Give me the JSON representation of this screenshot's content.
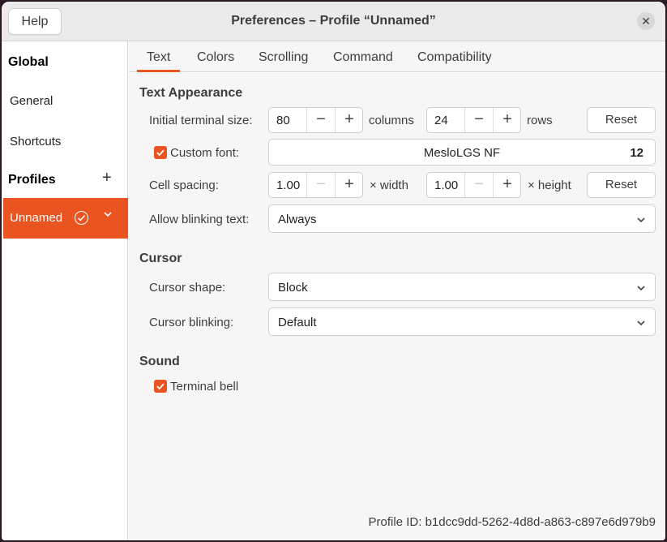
{
  "window": {
    "title": "Preferences – Profile “Unnamed”",
    "help_label": "Help",
    "close_glyph": "✕"
  },
  "sidebar": {
    "global_heading": "Global",
    "general": "General",
    "shortcuts": "Shortcuts",
    "profiles_heading": "Profiles",
    "add_glyph": "+",
    "profiles": [
      {
        "name": "Unnamed",
        "is_default": true,
        "selected": true
      }
    ]
  },
  "tabs": [
    {
      "label": "Text",
      "active": true
    },
    {
      "label": "Colors",
      "active": false
    },
    {
      "label": "Scrolling",
      "active": false
    },
    {
      "label": "Command",
      "active": false
    },
    {
      "label": "Compatibility",
      "active": false
    }
  ],
  "text_appearance": {
    "heading": "Text Appearance",
    "terminal_size": {
      "label": "Initial terminal size:",
      "columns_value": "80",
      "columns_unit": "columns",
      "rows_value": "24",
      "rows_unit": "rows",
      "reset_label": "Reset"
    },
    "custom_font": {
      "label": "Custom font:",
      "checked": true,
      "font_name": "MesloLGS NF",
      "font_size": "12"
    },
    "cell_spacing": {
      "label": "Cell spacing:",
      "width_value": "1.00",
      "width_unit": "× width",
      "height_value": "1.00",
      "height_unit": "× height",
      "reset_label": "Reset"
    },
    "blinking_text": {
      "label": "Allow blinking text:",
      "value": "Always"
    }
  },
  "cursor": {
    "heading": "Cursor",
    "shape_label": "Cursor shape:",
    "shape_value": "Block",
    "blinking_label": "Cursor blinking:",
    "blinking_value": "Default"
  },
  "sound": {
    "heading": "Sound",
    "bell_label": "Terminal bell",
    "bell_checked": true
  },
  "footer": {
    "profile_id_label": "Profile ID:",
    "profile_id": "b1dcc9dd-5262-4d8d-a863-c897e6d979b9"
  },
  "glyphs": {
    "minus": "−",
    "plus": "+"
  },
  "colors": {
    "accent": "#e95420",
    "titlebar": "#ebebeb",
    "content_bg": "#f6f6f6",
    "field_bg": "#ffffff",
    "border": "#cfcfcf"
  },
  "icons": {
    "default_profile": "check-circle-icon",
    "profile_menu": "chevron-down-icon",
    "dropdown": "chevron-down-icon",
    "checkbox": "checkmark-icon",
    "close": "close-icon",
    "add": "plus-icon"
  }
}
